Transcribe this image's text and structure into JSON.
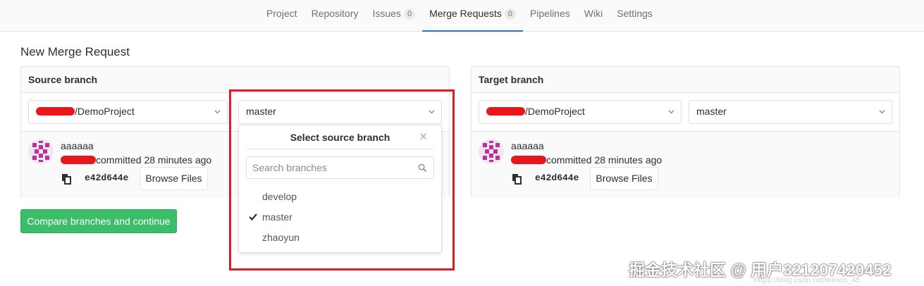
{
  "nav": {
    "tabs": [
      {
        "label": "Project"
      },
      {
        "label": "Repository"
      },
      {
        "label": "Issues",
        "badge": "0"
      },
      {
        "label": "Merge Requests",
        "badge": "0",
        "active": true
      },
      {
        "label": "Pipelines"
      },
      {
        "label": "Wiki"
      },
      {
        "label": "Settings"
      }
    ]
  },
  "page": {
    "title": "New Merge Request"
  },
  "source": {
    "heading": "Source branch",
    "project_select": "/DemoProject",
    "branch_select": "master",
    "commit": {
      "author": "aaaaaa",
      "committed": "committed 28 minutes ago",
      "sha": "e42d644e",
      "browse_label": "Browse Files"
    }
  },
  "target": {
    "heading": "Target branch",
    "project_select": "/DemoProject",
    "branch_select": "master",
    "commit": {
      "author": "aaaaaa",
      "committed": "committed 28 minutes ago",
      "sha": "e42d644e",
      "browse_label": "Browse Files"
    }
  },
  "dropdown": {
    "title": "Select source branch",
    "search_placeholder": "Search branches",
    "items": [
      {
        "label": "develop",
        "selected": false
      },
      {
        "label": "master",
        "selected": true
      },
      {
        "label": "zhaoyun",
        "selected": false
      }
    ]
  },
  "actions": {
    "compare_label": "Compare branches and continue"
  },
  "watermark": {
    "text": "掘金技术社区 @ 用户321207420452",
    "faint": "https://blog.csdn.net/weixin_45"
  },
  "colors": {
    "accent": "#1f78d1",
    "success": "#3cbd6a",
    "highlight": "#e01b23",
    "redaction": "#e8171b"
  }
}
